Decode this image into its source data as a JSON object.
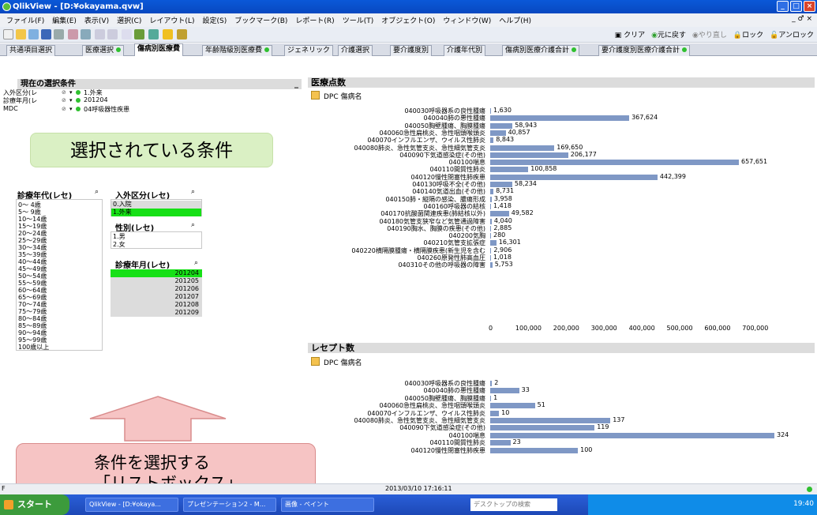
{
  "window": {
    "title": "QlikView - [D:¥okayama.qvw]",
    "min": "_",
    "max": "□",
    "close": "×"
  },
  "menu": [
    "ファイル(F)",
    "編集(E)",
    "表示(V)",
    "選択(C)",
    "レイアウト(L)",
    "設定(S)",
    "ブックマーク(B)",
    "レポート(R)",
    "ツール(T)",
    "オブジェクト(O)",
    "ウィンドウ(W)",
    "ヘルプ(H)"
  ],
  "mdi_controls": "_ ♂ ×",
  "toolbar_right": {
    "clear": "クリア",
    "back": "元に戻す",
    "redo": "やり直し",
    "lock": "ロック",
    "unlock": "アンロック"
  },
  "tabs": [
    {
      "label": "共通項目選択",
      "dot": false,
      "active": false
    },
    {
      "label": "医療選択",
      "dot": true,
      "active": false
    },
    {
      "label": "傷病別医療費",
      "dot": false,
      "active": true
    },
    {
      "label": "年齢階級別医療費",
      "dot": true,
      "active": false
    },
    {
      "label": "ジェネリック",
      "dot": false,
      "active": false
    },
    {
      "label": "介護選択",
      "dot": false,
      "active": false
    },
    {
      "label": "要介護度別",
      "dot": false,
      "active": false
    },
    {
      "label": "介護年代別",
      "dot": false,
      "active": false
    },
    {
      "label": "傷病別医療介護合計",
      "dot": true,
      "active": false
    },
    {
      "label": "要介護度別医療介護合計",
      "dot": true,
      "active": false
    }
  ],
  "current_selection": {
    "title": "現在の選択条件",
    "minimize": "_",
    "rows": [
      {
        "field": "入外区分(レ",
        "value": "1.外来"
      },
      {
        "field": "診療年月(レ",
        "value": "201204"
      },
      {
        "field": "MDC",
        "value": "04呼吸器性疾患"
      }
    ]
  },
  "banner": "選択されている条件",
  "listboxes": {
    "age": {
      "title": "診療年代(レセ)",
      "items": [
        "0～ 4歳",
        "5～ 9歳",
        "10～14歳",
        "15～19歳",
        "20～24歳",
        "25～29歳",
        "30～34歳",
        "35～39歳",
        "40～44歳",
        "45～49歳",
        "50～54歳",
        "55～59歳",
        "60～64歳",
        "65～69歳",
        "70～74歳",
        "75～79歳",
        "80～84歳",
        "85～89歳",
        "90～94歳",
        "95～99歳",
        "100歳以上"
      ]
    },
    "inout": {
      "title": "入外区分(レセ)",
      "items": [
        "0.入院",
        "1.外来"
      ],
      "selected": "1.外来"
    },
    "sex": {
      "title": "性別(レセ)",
      "items": [
        "1.男",
        "2.女"
      ]
    },
    "month": {
      "title": "診療年月(レセ)",
      "items": [
        "201204",
        "201205",
        "201206",
        "201207",
        "201208",
        "201209"
      ],
      "selected": "201204"
    }
  },
  "callout": {
    "line1": "条件を選択する",
    "line2": "「リストボックス」"
  },
  "chart1": {
    "title": "医療点数",
    "dim": "DPC 傷病名"
  },
  "chart2": {
    "title": "レセプト数",
    "dim": "DPC 傷病名"
  },
  "chart_data": [
    {
      "type": "bar",
      "orientation": "horizontal",
      "title": "医療点数",
      "xlim": [
        0,
        700000
      ],
      "ticks": [
        "0",
        "100,000",
        "200,000",
        "300,000",
        "400,000",
        "500,000",
        "600,000",
        "700,000"
      ],
      "categories": [
        "040030呼吸器系の良性腫瘍",
        "040040肺の悪性腫瘍",
        "040050胸壁腫瘍、胸膜腫瘍",
        "040060急性扁桃炎、急性咽頭喉頭炎",
        "040070インフルエンザ、ウイルス性肺炎",
        "040080肺炎、急性気管支炎、急性細気管支炎",
        "040090下気道感染症(その他)",
        "040100喘息",
        "040110間質性肺炎",
        "040120慢性閉塞性肺疾患",
        "040130呼吸不全(その他)",
        "040140気道出血(その他)",
        "040150肺・縦隔の感染、膿瘍形成",
        "040160呼吸器の結核",
        "040170抗酸菌関連疾患(肺結核以外)",
        "040180気管支狭窄など気管通過障害",
        "040190胸水、胸膜の疾患(その他)",
        "040200気胸",
        "040210気管支拡張症",
        "040220横隔膜腫瘍・横隔膜疾患(新生児を含む",
        "040260原発性肺高血圧",
        "040310その他の呼吸器の障害"
      ],
      "values": [
        1630,
        367624,
        58943,
        40857,
        8843,
        169650,
        206177,
        657651,
        100858,
        442399,
        58234,
        8731,
        3958,
        1418,
        49582,
        4040,
        2885,
        280,
        16301,
        2906,
        1018,
        5753
      ],
      "labels": [
        "1,630",
        "367,624",
        "58,943",
        "40,857",
        "8,843",
        "169,650",
        "206,177",
        "657,651",
        "100,858",
        "442,399",
        "58,234",
        "8,731",
        "3,958",
        "1,418",
        "49,582",
        "4,040",
        "2,885",
        "280",
        "16,301",
        "2,906",
        "1,018",
        "5,753"
      ]
    },
    {
      "type": "bar",
      "orientation": "horizontal",
      "title": "レセプト数",
      "xmax": 324,
      "categories": [
        "040030呼吸器系の良性腫瘍",
        "040040肺の悪性腫瘍",
        "040050胸壁腫瘍、胸膜腫瘍",
        "040060急性扁桃炎、急性咽頭喉頭炎",
        "040070インフルエンザ、ウイルス性肺炎",
        "040080肺炎、急性気管支炎、急性細気管支炎",
        "040090下気道感染症(その他)",
        "040100喘息",
        "040110間質性肺炎",
        "040120慢性閉塞性肺疾患"
      ],
      "values": [
        2,
        33,
        1,
        51,
        10,
        137,
        119,
        324,
        23,
        100
      ],
      "labels": [
        "2",
        "33",
        "1",
        "51",
        "10",
        "137",
        "119",
        "324",
        "23",
        "100"
      ]
    }
  ],
  "status": {
    "timestamp": "2013/03/10 17:16:11",
    "left": "F"
  },
  "taskbar": {
    "start": "スタート",
    "tasks": [
      "QlikView - [D:¥okaya...",
      "プレゼンテーション2 - M...",
      "画像 - ペイント"
    ],
    "search": "デスクトップの検索",
    "clock": "19:40"
  }
}
